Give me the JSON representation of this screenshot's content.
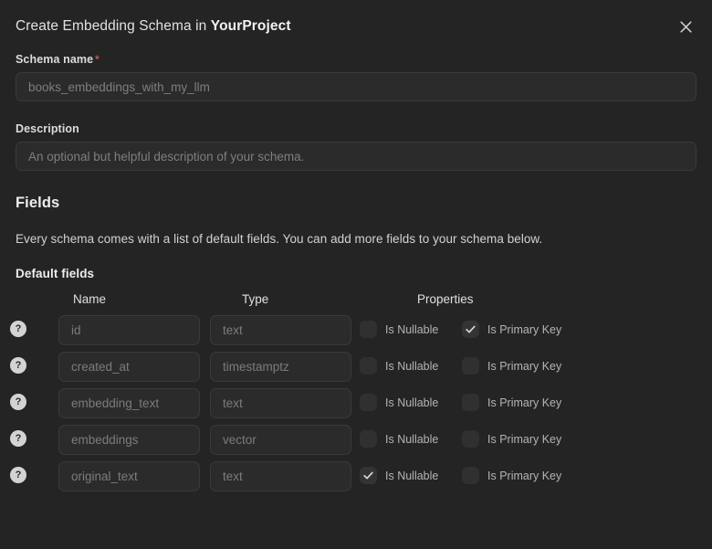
{
  "header": {
    "title_prefix": "Create Embedding Schema in ",
    "project_name": "YourProject",
    "close_icon": "close-icon"
  },
  "schema_name": {
    "label": "Schema name",
    "required_marker": "*",
    "value": "",
    "placeholder": "books_embeddings_with_my_llm"
  },
  "description": {
    "label": "Description",
    "value": "",
    "placeholder": "An optional but helpful description of your schema."
  },
  "fields_section": {
    "heading": "Fields",
    "description": "Every schema comes with a list of default fields. You can add more fields to your schema below.",
    "subheading": "Default fields",
    "columns": {
      "name": "Name",
      "type": "Type",
      "properties": "Properties"
    },
    "property_labels": {
      "nullable": "Is Nullable",
      "primary_key": "Is Primary Key"
    },
    "help_icon_glyph": "?",
    "rows": [
      {
        "name_placeholder": "id",
        "name_value": "",
        "type_placeholder": "text",
        "type_value": "",
        "is_nullable": false,
        "is_primary_key": true
      },
      {
        "name_placeholder": "created_at",
        "name_value": "",
        "type_placeholder": "timestamptz",
        "type_value": "",
        "is_nullable": false,
        "is_primary_key": false
      },
      {
        "name_placeholder": "embedding_text",
        "name_value": "",
        "type_placeholder": "text",
        "type_value": "",
        "is_nullable": false,
        "is_primary_key": false
      },
      {
        "name_placeholder": "embeddings",
        "name_value": "",
        "type_placeholder": "vector",
        "type_value": "",
        "is_nullable": false,
        "is_primary_key": false
      },
      {
        "name_placeholder": "original_text",
        "name_value": "",
        "type_placeholder": "text",
        "type_value": "",
        "is_nullable": true,
        "is_primary_key": false
      }
    ]
  },
  "colors": {
    "background": "#242424",
    "input_background": "#2b2b2b",
    "input_border": "#3a3a3a",
    "required_star": "#b45b4f",
    "text_primary": "#e8e8e8",
    "text_muted": "#8a8a8a"
  }
}
